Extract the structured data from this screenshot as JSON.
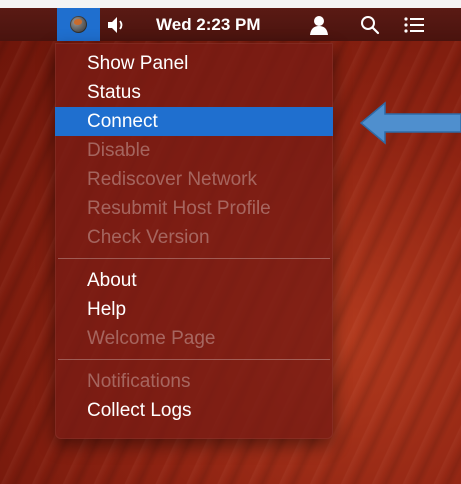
{
  "menubar": {
    "clock": "Wed 2:23 PM",
    "icons": {
      "app": "globe-icon",
      "volume": "speaker-icon",
      "user": "user-icon",
      "search": "search-icon",
      "list": "list-icon"
    },
    "highlight_color": "#1f6fcf"
  },
  "menu": {
    "sections": [
      [
        {
          "label": "Show Panel",
          "enabled": true
        },
        {
          "label": "Status",
          "enabled": true
        },
        {
          "label": "Connect",
          "enabled": true,
          "highlighted": true
        },
        {
          "label": "Disable",
          "enabled": false
        },
        {
          "label": "Rediscover Network",
          "enabled": false
        },
        {
          "label": "Resubmit Host Profile",
          "enabled": false
        },
        {
          "label": "Check Version",
          "enabled": false
        }
      ],
      [
        {
          "label": "About",
          "enabled": true
        },
        {
          "label": "Help",
          "enabled": true
        },
        {
          "label": "Welcome Page",
          "enabled": false
        }
      ],
      [
        {
          "label": "Notifications",
          "enabled": false
        },
        {
          "label": "Collect Logs",
          "enabled": true
        }
      ]
    ]
  },
  "annotation": {
    "arrow_icon": "left-arrow-icon",
    "arrow_color": "#4f8fce"
  }
}
